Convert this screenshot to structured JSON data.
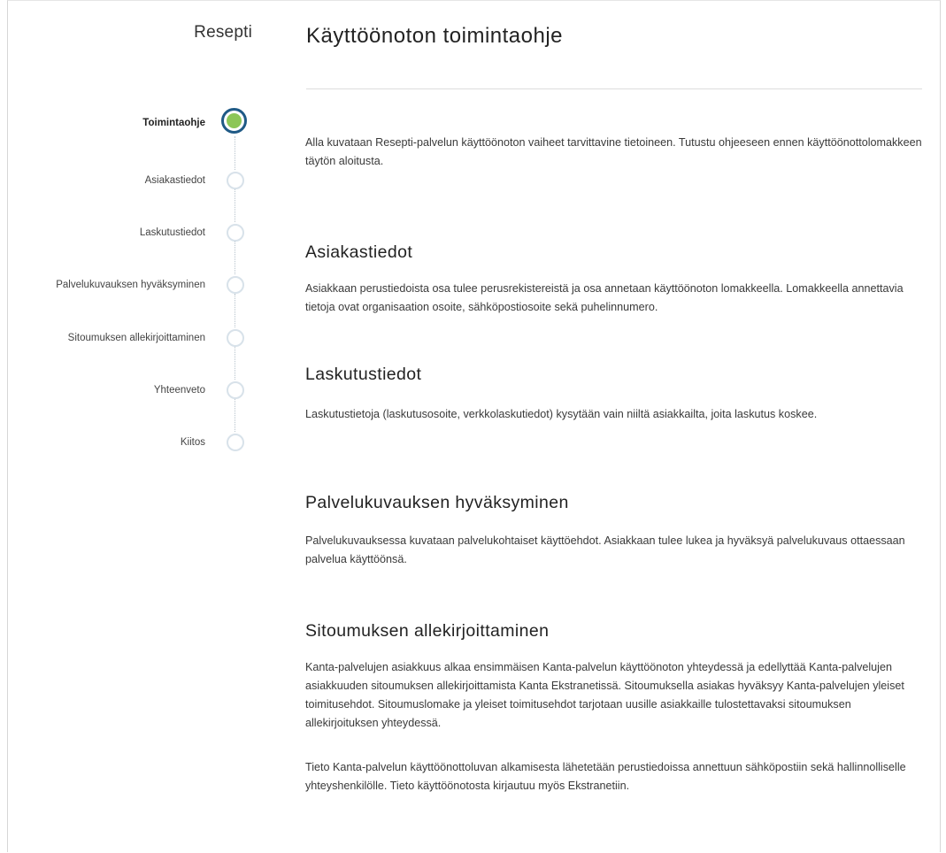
{
  "app": {
    "title": "Resepti"
  },
  "stepper": {
    "steps": [
      {
        "label": "Toimintaohje",
        "state": "active"
      },
      {
        "label": "Asiakastiedot",
        "state": "pending"
      },
      {
        "label": "Laskutustiedot",
        "state": "pending"
      },
      {
        "label": "Palvelukuvauksen hyväksyminen",
        "state": "pending"
      },
      {
        "label": "Sitoumuksen allekirjoittaminen",
        "state": "pending"
      },
      {
        "label": "Yhteenveto",
        "state": "pending"
      },
      {
        "label": "Kiitos",
        "state": "pending"
      }
    ],
    "colors": {
      "active_ring": "#1f5a86",
      "active_fill": "#8cc657",
      "pending_ring": "#d8e2ea"
    }
  },
  "main": {
    "page_title": "Käyttöönoton toimintaohje",
    "intro": "Alla kuvataan Resepti-palvelun käyttöönoton vaiheet tarvittavine tietoineen. Tutustu ohjeeseen ennen käyttöönottolomakkeen täytön aloitusta.",
    "sections": [
      {
        "title": "Asiakastiedot",
        "paragraphs": [
          "Asiakkaan perustiedoista osa tulee perusrekistereistä ja osa annetaan käyttöönoton lomakkeella. Lomakkeella annettavia tietoja ovat organisaation osoite, sähköpostiosoite sekä puhelinnumero."
        ]
      },
      {
        "title": "Laskutustiedot",
        "paragraphs": [
          "Laskutustietoja (laskutusosoite, verkkolaskutiedot) kysytään vain niiltä asiakkailta, joita laskutus koskee."
        ]
      },
      {
        "title": "Palvelukuvauksen hyväksyminen",
        "paragraphs": [
          "Palvelukuvauksessa kuvataan palvelukohtaiset käyttöehdot. Asiakkaan tulee lukea ja hyväksyä palvelukuvaus ottaessaan palvelua käyttöönsä."
        ]
      },
      {
        "title": "Sitoumuksen allekirjoittaminen",
        "paragraphs": [
          "Kanta-palvelujen asiakkuus alkaa ensimmäisen Kanta-palvelun käyttöönoton yhteydessä ja edellyttää Kanta-palvelujen asiakkuuden sitoumuksen allekirjoittamista Kanta Ekstranetissä. Sitoumuksella asiakas hyväksyy Kanta-palvelujen yleiset toimitusehdot. Sitoumuslomake ja yleiset toimitusehdot tarjotaan uusille asiakkaille tulostettavaksi sitoumuksen allekirjoituksen yhteydessä.",
          "Tieto Kanta-palvelun käyttöönottoluvan alkamisesta lähetetään perustiedoissa annettuun sähköpostiin sekä hallinnolliselle yhteyshenkilölle. Tieto käyttöönotosta kirjautuu myös Ekstranetiin."
        ]
      }
    ]
  }
}
